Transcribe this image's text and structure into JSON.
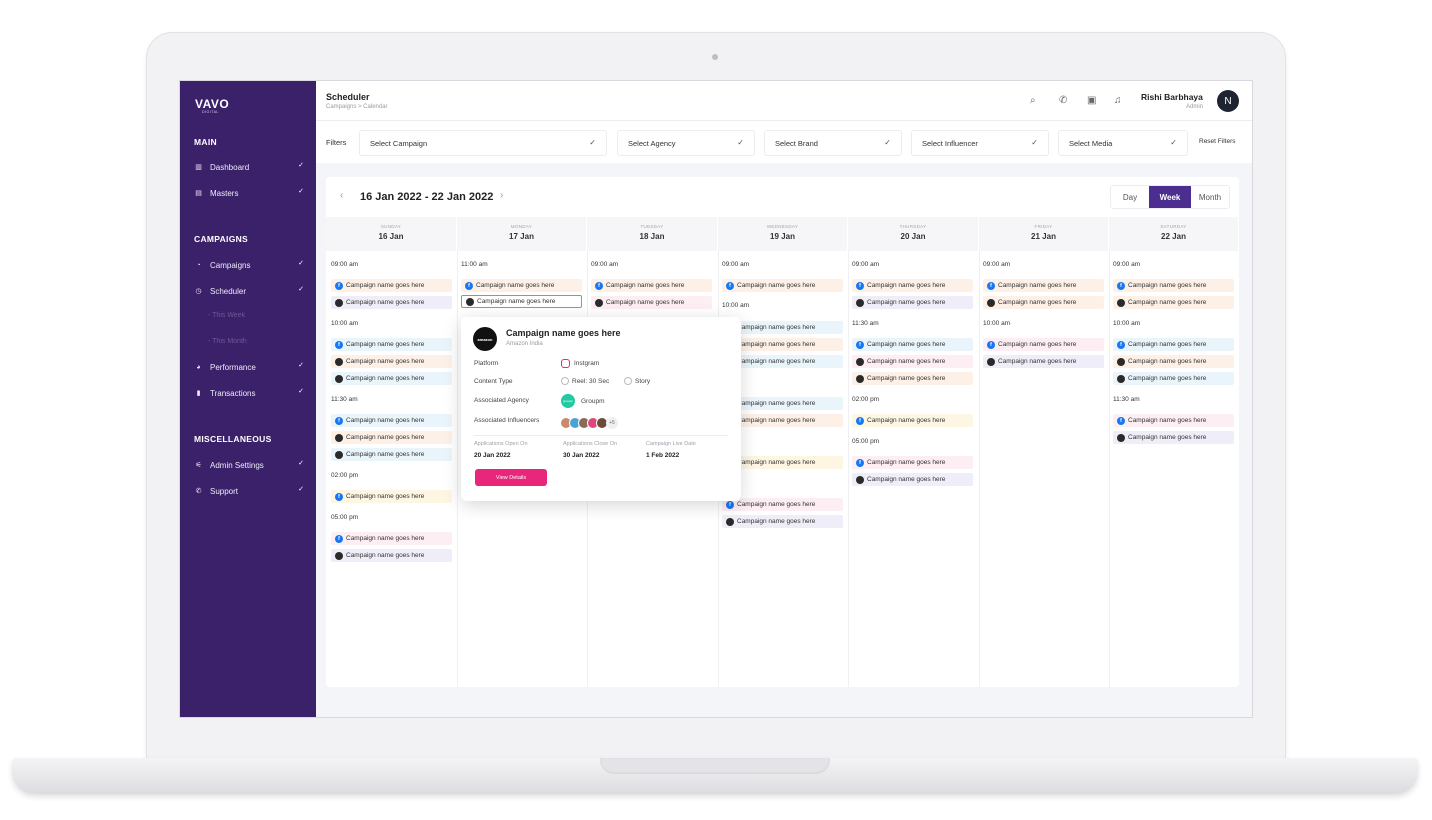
{
  "app": {
    "logo": "VAVO",
    "logo_sub": "DIGITAL"
  },
  "sidebar": {
    "sections": [
      "MAIN",
      "CAMPAIGNS",
      "MISCELLANEOUS"
    ],
    "items": [
      {
        "label": "Dashboard",
        "icon": "bar-chart-icon"
      },
      {
        "label": "Masters",
        "icon": "grid-icon"
      },
      {
        "label": "Campaigns",
        "icon": "megaphone-icon"
      },
      {
        "label": "Scheduler",
        "icon": "clock-icon"
      },
      {
        "label": "Performance",
        "icon": "pie-chart-icon"
      },
      {
        "label": "Transactions",
        "icon": "receipt-icon"
      },
      {
        "label": "Admin Settings",
        "icon": "sliders-icon"
      },
      {
        "label": "Support",
        "icon": "phone-icon"
      }
    ],
    "sub_items": [
      "This Week",
      "This Month"
    ]
  },
  "header": {
    "title": "Scheduler",
    "breadcrumb": "Campaigns > Calendar",
    "icons": [
      "search-icon",
      "phone-icon",
      "chat-icon",
      "bell-icon"
    ],
    "user_name": "Rishi Barbhaya",
    "user_role": "Admin",
    "avatar_initial": "N"
  },
  "filters": {
    "label": "Filters",
    "campaign": "Select Campaign",
    "agency": "Select Agency",
    "brand": "Select Brand",
    "influencer": "Select Influencer",
    "media": "Select Media",
    "reset": "Reset Filters"
  },
  "calendar": {
    "range": "16 Jan 2022 - 22 Jan 2022",
    "views": [
      "Day",
      "Week",
      "Month"
    ],
    "active_view": "Week",
    "days": [
      {
        "name": "SUNDAY",
        "date": "16 Jan"
      },
      {
        "name": "MONDAY",
        "date": "17 Jan"
      },
      {
        "name": "TUESDAY",
        "date": "18 Jan"
      },
      {
        "name": "WEDNESDAY",
        "date": "19 Jan"
      },
      {
        "name": "THURSDAY",
        "date": "20 Jan"
      },
      {
        "name": "FRIDAY",
        "date": "21 Jan"
      },
      {
        "name": "SATURDAY",
        "date": "22 Jan"
      }
    ],
    "event_label": "Campaign name goes here",
    "times": {
      "t0900": "09:00 am",
      "t1000": "10:00 am",
      "t1100": "11:00 am",
      "t1130": "11:30 am",
      "t0200": "02:00 pm",
      "t0500": "05:00 pm",
      "t_am": "am",
      "t_pm": "pm"
    }
  },
  "popover": {
    "logo_text": "amazon",
    "title": "Campaign name goes here",
    "subtitle": "Amazon India",
    "platform_label": "Platform",
    "platform_value": "Instgram",
    "content_type_label": "Content Type",
    "content_type_1": "Reel: 30 Sec",
    "content_type_2": "Story",
    "agency_label": "Associated Agency",
    "agency_logo_text": "groupm",
    "agency_value": "Groupm",
    "influencers_label": "Associated Influencers",
    "influencers_more": "+5",
    "open_label": "Applications Open On",
    "open_date": "20 Jan 2022",
    "close_label": "Applications Close On",
    "close_date": "30 Jan 2022",
    "live_label": "Campaign Live Date",
    "live_date": "1 Feb 2022",
    "button": "View Details"
  },
  "colors": {
    "sidebar": "#3a2169",
    "accent": "#4b2e8f",
    "button": "#e8267a",
    "facebook": "#1877f2"
  }
}
